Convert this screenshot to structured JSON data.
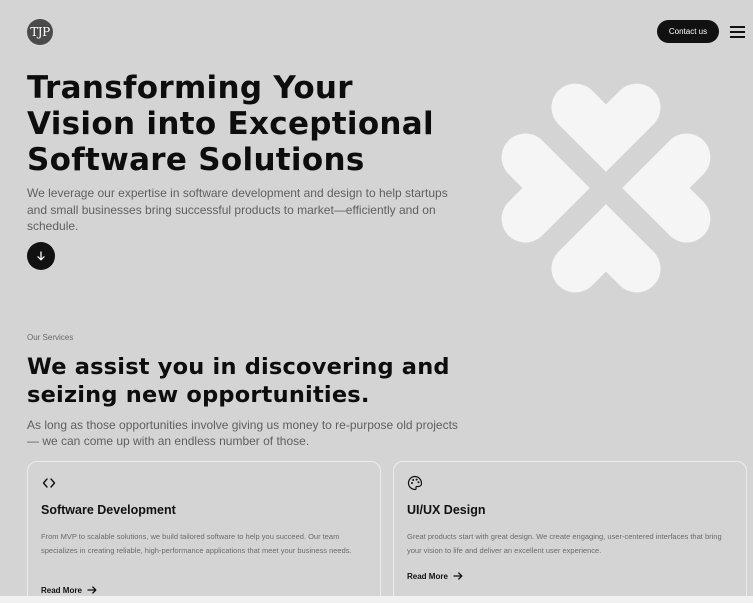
{
  "header": {
    "logo_text": "TJP",
    "contact_label": "Contact us",
    "menu_icon": "hamburger-menu-icon"
  },
  "hero": {
    "title": "Transforming Your Vision into Exceptional Software Solutions",
    "description": "We leverage our expertise in software development and design to help startups and small businesses bring successful products to market—efficiently and on schedule.",
    "scroll_icon": "arrow-down-icon",
    "decoration_icon": "four-heart-clover-icon"
  },
  "services": {
    "label": "Our Services",
    "title": "We assist you in discovering and seizing new opportunities.",
    "description": "As long as those opportunities involve giving us money to re-purpose old projects — we can come up with an endless number of those.",
    "cards": [
      {
        "icon": "code-brackets-icon",
        "title": "Software Development",
        "description": "From MVP to scalable solutions, we build tailored software to help you succeed. Our team specializes in creating reliable, high-performance applications that meet your business needs.",
        "link_label": "Read More"
      },
      {
        "icon": "palette-icon",
        "title": "UI/UX Design",
        "description": "Great products start with great design. We create engaging, user-centered interfaces that bring your vision to life and deliver an excellent user experience.",
        "link_label": "Read More"
      }
    ]
  },
  "colors": {
    "background": "#d4d4d4",
    "primary": "#111111",
    "muted_text": "#5f5f5f",
    "decoration": "#f5f5f5"
  }
}
